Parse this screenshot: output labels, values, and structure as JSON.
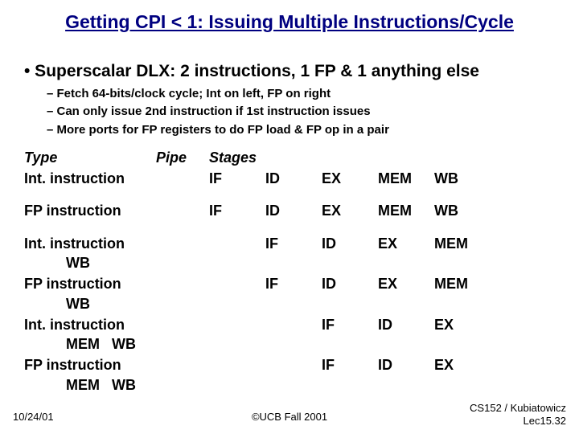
{
  "title": "Getting CPI < 1: Issuing Multiple Instructions/Cycle",
  "main_bullet": "• Superscalar DLX: 2 instructions, 1 FP & 1 anything else",
  "sub_bullets": [
    "– Fetch 64-bits/clock cycle; Int on left, FP on right",
    "– Can only issue 2nd instruction if 1st instruction issues",
    "– More ports for FP registers to do FP load & FP op in a pair"
  ],
  "header": {
    "c0": "Type",
    "c1": "Pipe",
    "c2": "Stages"
  },
  "rows": [
    {
      "c0": "Int. instruction",
      "s": [
        "IF",
        "ID",
        "EX",
        "MEM",
        "WB"
      ],
      "off": 0
    },
    {
      "c0": "FP instruction",
      "s": [
        "IF",
        "ID",
        "EX",
        "MEM",
        "WB"
      ],
      "off": 0,
      "gap": true
    },
    {
      "c0": "Int. instruction",
      "s": [
        "IF",
        "ID",
        "EX",
        "MEM",
        "WB"
      ],
      "off": 1,
      "wrap_last": 1,
      "gap": true
    },
    {
      "c0": "FP instruction",
      "s": [
        "IF",
        "ID",
        "EX",
        "MEM",
        "WB"
      ],
      "off": 1,
      "wrap_last": 1
    },
    {
      "c0": "Int. instruction",
      "s": [
        "IF",
        "ID",
        "EX",
        "MEM",
        "WB"
      ],
      "off": 2,
      "wrap_last": 2
    },
    {
      "c0": "FP instruction",
      "s": [
        "IF",
        "ID",
        "EX",
        "MEM",
        "WB"
      ],
      "off": 2,
      "wrap_last": 2
    }
  ],
  "footer": {
    "date": "10/24/01",
    "center": "©UCB Fall 2001",
    "right1": "CS152 / Kubiatowicz",
    "right2": "Lec15.32"
  }
}
